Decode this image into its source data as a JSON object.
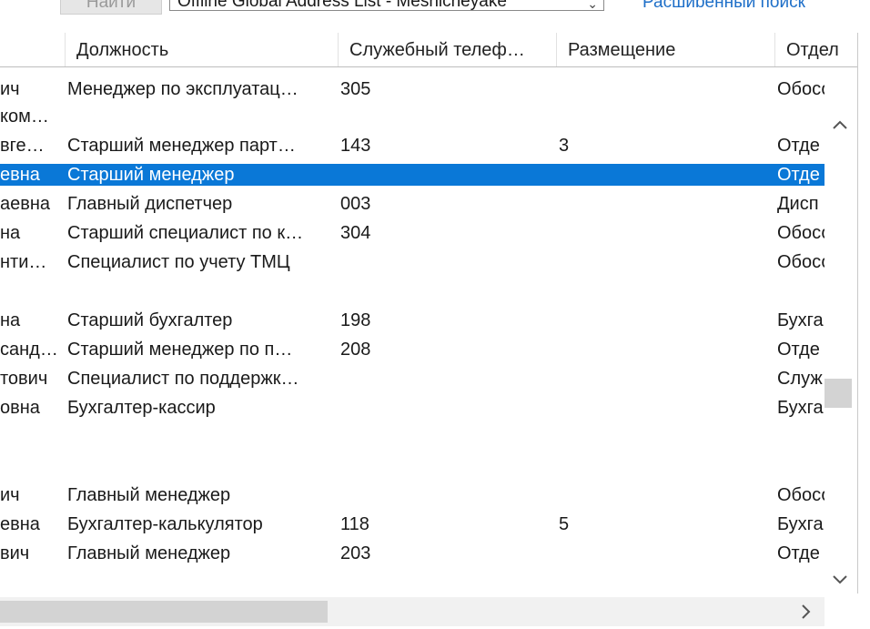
{
  "toolbar": {
    "find_label": "Найти",
    "address_book": "Offline Global Address List - Mesnicneyake",
    "advanced_search": "Расширенный поиск"
  },
  "columns": {
    "title": "Должность",
    "phone": "Служебный телеф…",
    "location": "Размещение",
    "department": "Отдел"
  },
  "rows": [
    {
      "name": "ич",
      "name2": "ком…",
      "title": "Менеджер по эксплуатац…",
      "phone": "305",
      "location": "",
      "department": "Обосо"
    },
    {
      "name": "вге…",
      "title": "Старший менеджер парт…",
      "phone": "143",
      "location": "3",
      "department": "Отде"
    },
    {
      "name": "евна",
      "title": "Старший менеджер",
      "phone": "",
      "location": "",
      "department": "Отде",
      "selected": true
    },
    {
      "name": "аевна",
      "title": "Главный диспетчер",
      "phone": "003",
      "location": "",
      "department": "Дисп"
    },
    {
      "name": "на",
      "title": "Старший специалист по к…",
      "phone": "304",
      "location": "",
      "department": "Обосо"
    },
    {
      "name": "нти…",
      "title": "Специалист по учету ТМЦ",
      "phone": "",
      "location": "",
      "department": "Обосо"
    },
    {
      "name": "на",
      "title": "Старший бухгалтер",
      "phone": "198",
      "location": "",
      "department": "Бухга"
    },
    {
      "name": "санд…",
      "title": "Старший менеджер по п…",
      "phone": "208",
      "location": "",
      "department": "Отде"
    },
    {
      "name": "тович",
      "title": "Специалист по поддержк…",
      "phone": "",
      "location": "",
      "department": "Служ"
    },
    {
      "name": "овна",
      "title": "Бухгалтер-кассир",
      "phone": "",
      "location": "",
      "department": "Бухга"
    },
    {
      "name": "ич",
      "title": "Главный менеджер",
      "phone": "",
      "location": "",
      "department": "Обосо"
    },
    {
      "name": "евна",
      "title": "Бухгалтер-калькулятор",
      "phone": "118",
      "location": "5",
      "department": "Бухга"
    },
    {
      "name": "вич",
      "title": "Главный менеджер",
      "phone": "203",
      "location": "",
      "department": "Отде"
    }
  ],
  "icons": {
    "scroll_up": "chevron-up-icon",
    "scroll_down": "chevron-down-icon",
    "scroll_right": "chevron-right-icon",
    "dropdown": "chevron-down-icon"
  },
  "colors": {
    "selection": "#0a78d7",
    "link": "#1e6fc8"
  }
}
